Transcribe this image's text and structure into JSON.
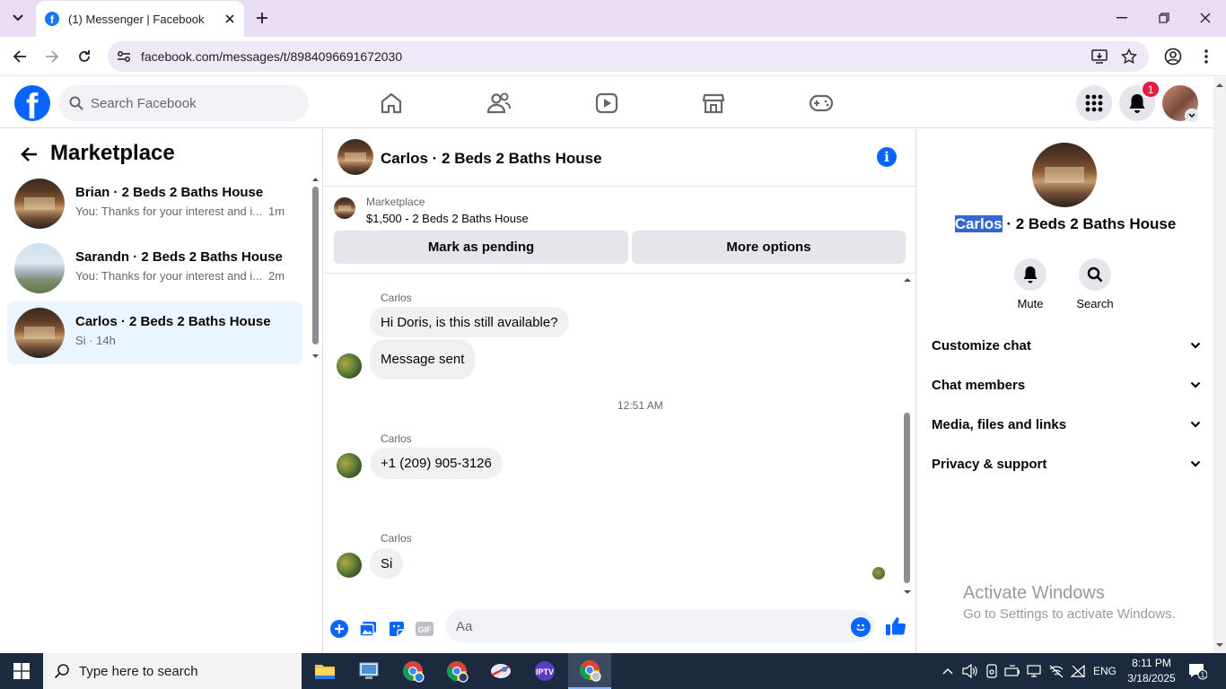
{
  "browser": {
    "tab_title": "(1) Messenger | Facebook",
    "url": "facebook.com/messages/t/8984096691672030"
  },
  "fb_nav": {
    "search_placeholder": "Search Facebook",
    "notification_count": "1"
  },
  "left_pane": {
    "title": "Marketplace",
    "conversations": [
      {
        "name": "Brian · 2 Beds 2 Baths House",
        "snippet": "You: Thanks for your interest and i...",
        "time": "1m"
      },
      {
        "name": "Sarandn · 2 Beds 2 Baths House",
        "snippet": "You: Thanks for your interest and i...",
        "time": "2m"
      },
      {
        "name": "Carlos · 2 Beds 2 Baths House",
        "snippet": "Si · 14h",
        "time": ""
      }
    ]
  },
  "chat": {
    "title": "Carlos · 2 Beds 2 Baths House",
    "listing_label": "Marketplace",
    "listing_price": "$1,500 - 2 Beds 2 Baths House",
    "mark_pending": "Mark as pending",
    "more_options": "More options",
    "messages": {
      "sender1": "Carlos",
      "msg1": "Hi Doris, is this still available?",
      "msg2": "Message sent",
      "timestamp": "12:51 AM",
      "sender2": "Carlos",
      "msg3": "+1 (209) 905-3126",
      "sender3": "Carlos",
      "msg4": "Si"
    },
    "composer_placeholder": "Aa"
  },
  "right_pane": {
    "name_highlight": "Carlos",
    "name_rest": " · 2 Beds 2 Baths House",
    "mute_label": "Mute",
    "search_label": "Search",
    "sections": [
      "Customize chat",
      "Chat members",
      "Media, files and links",
      "Privacy & support"
    ]
  },
  "watermark": {
    "line1": "Activate Windows",
    "line2": "Go to Settings to activate Windows."
  },
  "taskbar": {
    "search_placeholder": "Type here to search",
    "language": "ENG",
    "time": "8:11 PM",
    "date": "3/18/2025",
    "notif_count": "1"
  },
  "colors": {
    "fb_blue": "#0866ff",
    "active_conv": "#ebf5ff",
    "badge_red": "#e41e3f",
    "tabbar": "#e9ddf5",
    "taskbar": "#1b2a3f"
  }
}
